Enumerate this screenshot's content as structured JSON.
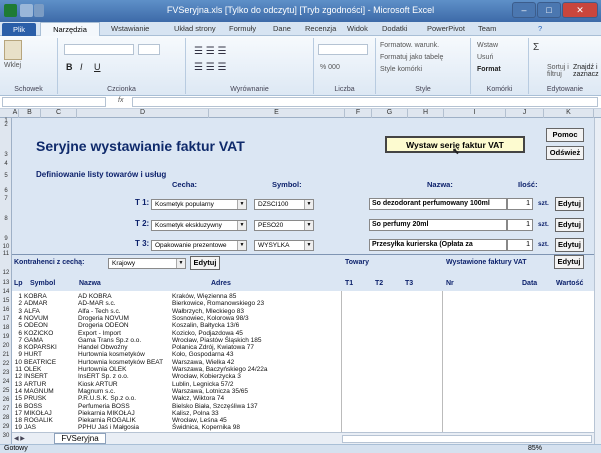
{
  "window": {
    "title": "FVSeryjna.xls  [Tylko do odczytu]  [Tryb zgodności] - Microsoft Excel"
  },
  "ribbon": {
    "tabs": [
      "Plik",
      "Narzędzia główne",
      "Wstawianie",
      "Układ strony",
      "Formuły",
      "Dane",
      "Recenzja",
      "Widok",
      "Dodatki",
      "PowerPivot",
      "Team"
    ],
    "groups": [
      "Schowek",
      "Czcionka",
      "Wyrównanie",
      "Liczba",
      "Style",
      "Komórki",
      "Edytowanie"
    ],
    "items": {
      "paste": "Wklej",
      "number_format": "% 000",
      "conditional": "Formatow. warunk.",
      "as_table": "Formatuj jako tabelę",
      "cell_styles": "Style komórki",
      "insert": "Wstaw",
      "delete": "Usuń",
      "format": "Format",
      "sort": "Sortuj i filtruj",
      "find": "Znajdź i zaznacz"
    }
  },
  "formula_bar": {
    "fx": "fx"
  },
  "columns": [
    "A",
    "B",
    "C",
    "D",
    "E",
    "F",
    "G",
    "H",
    "I",
    "J",
    "K"
  ],
  "rows": [
    "1",
    "2",
    "3",
    "4",
    "5",
    "6",
    "7",
    "8",
    "9",
    "10",
    "11",
    "12",
    "13",
    "14",
    "15",
    "16",
    "17",
    "18",
    "19",
    "20",
    "21",
    "22",
    "23",
    "24",
    "25",
    "26",
    "27",
    "28",
    "29",
    "30"
  ],
  "sheet": {
    "title": "Seryjne wystawianie faktur VAT",
    "pomoc": "Pomoc",
    "odswiez": "Odśwież",
    "wystaw": "Wystaw serię faktur VAT",
    "definition_title": "Definiowanie listy towarów i usług",
    "cecha_label": "Cecha:",
    "symbol_label": "Symbol:",
    "nazwa_label": "Nazwa:",
    "ilosc_label": "Ilość:",
    "unit": "szt.",
    "edit": "Edytuj",
    "products": [
      {
        "label": "T 1:",
        "cecha": "Kosmetyk popularny",
        "symbol": "DZSCI100",
        "nazwa": "So dezodorant perfumowany 100ml",
        "ilosc": "1"
      },
      {
        "label": "T 2:",
        "cecha": "Kosmetyk ekskluzywny",
        "symbol": "PESO20",
        "nazwa": "So perfumy 20ml",
        "ilosc": "1"
      },
      {
        "label": "T 3:",
        "cecha": "Opakowanie prezentowe",
        "symbol": "WYSYLKA",
        "nazwa": "Przesyłka kurierska (Opłata za",
        "ilosc": "1"
      }
    ],
    "kontrahenci_label": "Kontrahenci z cechą:",
    "kontrahenci_value": "Krajowy",
    "towary_label": "Towary",
    "wystawione_label": "Wystawione faktury VAT",
    "headers": {
      "lp": "Lp",
      "symbol": "Symbol",
      "nazwa": "Nazwa",
      "adres": "Adres",
      "t1": "T1",
      "t2": "T2",
      "t3": "T3",
      "nr": "Nr",
      "data": "Data",
      "wartosc": "Wartość"
    },
    "contractors": [
      {
        "lp": "1",
        "symbol": "KOBRA",
        "nazwa": "AD KOBRA",
        "adres": "Kraków, Więzienna  85"
      },
      {
        "lp": "2",
        "symbol": "ADMAR",
        "nazwa": "AD-MAR s.c.",
        "adres": "Bierkowice, Romanowskiego  23"
      },
      {
        "lp": "3",
        "symbol": "ALFA",
        "nazwa": "Alfa - Tech s.c.",
        "adres": "Wałbrzych, Mleckiego  83"
      },
      {
        "lp": "4",
        "symbol": "NOVUM",
        "nazwa": "Drogeria NOVUM",
        "adres": "Sosnowiec, Kolorowa  98/3"
      },
      {
        "lp": "5",
        "symbol": "ODEON",
        "nazwa": "Drogeria ODEON",
        "adres": "Koszalin, Bałtycka  13/6"
      },
      {
        "lp": "6",
        "symbol": "KOZICKO",
        "nazwa": "Export - Import",
        "adres": "Kozicko, Podjazdowa  45"
      },
      {
        "lp": "7",
        "symbol": "GAMA",
        "nazwa": "Gama Trans Sp.z o.o.",
        "adres": "Wrocław, Piastów Śląskich  185"
      },
      {
        "lp": "8",
        "symbol": "KOPARSKI",
        "nazwa": "Handel Obwoźny",
        "adres": "Polanica Zdrój, Kwiatowa  77"
      },
      {
        "lp": "9",
        "symbol": "HURT",
        "nazwa": "Hurtownia kosmetyków",
        "adres": "Koło, Gospodarna  43"
      },
      {
        "lp": "10",
        "symbol": "BEATRICE",
        "nazwa": "Hurtownia kosmetyków BEAT",
        "adres": "Warszawa, Wielka  42"
      },
      {
        "lp": "11",
        "symbol": "OLEK",
        "nazwa": "Hurtownia OLEK",
        "adres": "Warszawa, Baczyńskiego  24/22a"
      },
      {
        "lp": "12",
        "symbol": "INSERT",
        "nazwa": "InsERT Sp. z o.o.",
        "adres": "Wrocław, Kobierzycka  3"
      },
      {
        "lp": "13",
        "symbol": "ARTUR",
        "nazwa": "Kiosk ARTUR",
        "adres": "Lublin, Legnicka  57/2"
      },
      {
        "lp": "14",
        "symbol": "MAGNUM",
        "nazwa": "Magnum s.c.",
        "adres": "Warszawa, Lotnicza  35/65"
      },
      {
        "lp": "15",
        "symbol": "PRUSK",
        "nazwa": "P.R.U.S.K. Sp.z o.o.",
        "adres": "Wałcz, Wiktora  74"
      },
      {
        "lp": "16",
        "symbol": "BOSS",
        "nazwa": "Perfumeria BOSS",
        "adres": "Bielsko Biała, Szczęśliwa  137"
      },
      {
        "lp": "17",
        "symbol": "MIKOŁAJ",
        "nazwa": "Piekarnia MIKOŁAJ",
        "adres": "Kalisz, Polna  33"
      },
      {
        "lp": "18",
        "symbol": "ROGALIK",
        "nazwa": "Piekarnia ROGALIK",
        "adres": "Wrocław, Leśna  45"
      },
      {
        "lp": "19",
        "symbol": "JAS",
        "nazwa": "PPHU Jaś i Małgosia",
        "adres": "Świdnica, Kopernika  98"
      }
    ]
  },
  "sheet_tab": "FVSeryjna",
  "status": {
    "left": "Gotowy",
    "zoom": "85%"
  }
}
